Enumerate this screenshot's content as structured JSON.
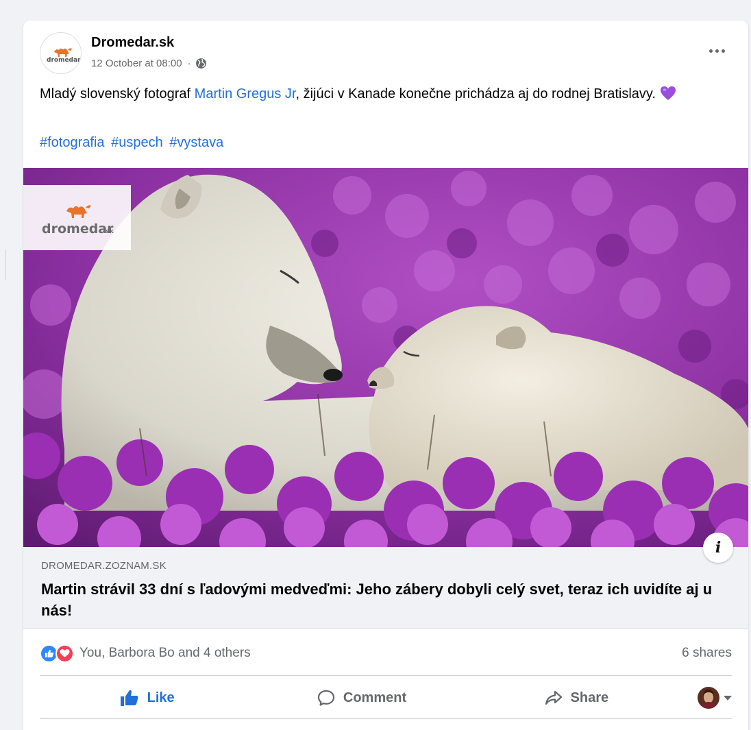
{
  "post": {
    "author": "Dromedar.sk",
    "timestamp": "12 October at 08:00",
    "audience_icon": "globe-icon",
    "text_before_mention": "Mladý slovenský fotograf ",
    "mention": "Martin Gregus Jr",
    "text_after_mention": ", žijúci v Kanade konečne prichádza aj do rodnej Bratislavy. ",
    "emoji": "purple-heart-icon",
    "hashtags": [
      "#fotografia",
      "#uspech",
      "#vystava"
    ]
  },
  "link_preview": {
    "logo_text": "dromedar",
    "logo_suffix": ".sk",
    "domain": "DROMEDAR.ZOZNAM.SK",
    "title": "Martin strávil 33 dní s ľadovými medveďmi: Jeho zábery dobyli celý svet, teraz ich uvidíte aj u nás!",
    "info_glyph": "i"
  },
  "engagement": {
    "reactions_summary": "You, Barbora Bo and 4 others",
    "shares": "6 shares",
    "reaction_icons": [
      "like-reaction-icon",
      "love-reaction-icon"
    ]
  },
  "actions": {
    "like_label": "Like",
    "comment_label": "Comment",
    "share_label": "Share"
  },
  "colors": {
    "accent": "#216fdb",
    "secondary_text": "#65676b",
    "page_bg": "#f0f2f5"
  }
}
